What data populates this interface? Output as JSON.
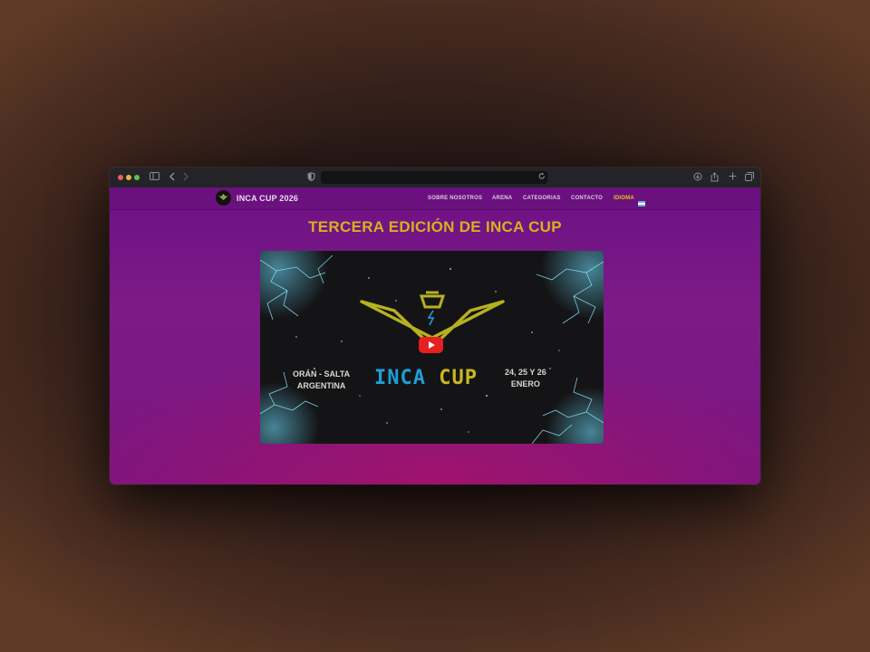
{
  "browser": {
    "url": ""
  },
  "site": {
    "brand": "INCA CUP 2026",
    "nav": {
      "items": [
        "SOBRE NOSOTROS",
        "ARENA",
        "CATEGORIAS",
        "CONTACTO"
      ],
      "language_label": "IDIOMA"
    },
    "headline": "TERCERA EDICIÓN DE INCA CUP",
    "video": {
      "logo_word_1": "INCA",
      "logo_word_2": "CUP",
      "location_line_1": "ORÁN - SALTA",
      "location_line_2": "ARGENTINA",
      "dates_line_1": "24, 25 Y 26",
      "dates_line_2": "ENERO",
      "colors": {
        "inca": "#1e9fd8",
        "cup": "#c9b81e",
        "emblem": "#b7b11f",
        "play": "#e81f1f"
      }
    }
  },
  "colors": {
    "page_bg": "#7a1580",
    "headline": "#d6b21c",
    "language_accent": "#e8c21a"
  }
}
